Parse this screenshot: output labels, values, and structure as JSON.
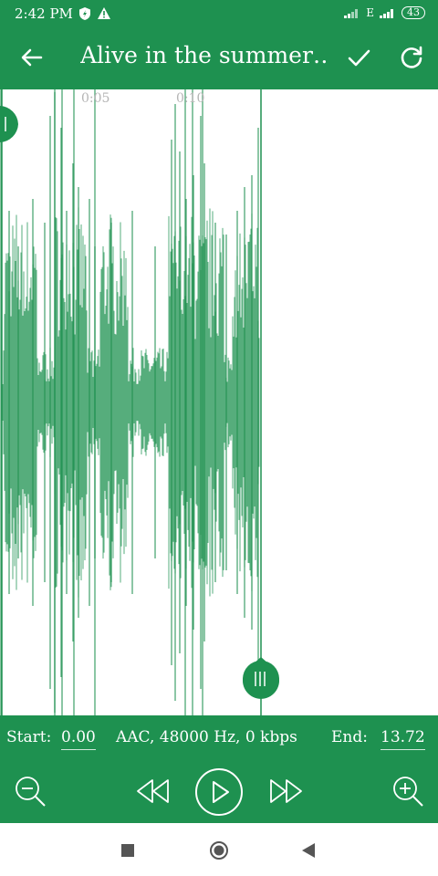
{
  "status": {
    "time": "2:42 PM",
    "network": "E",
    "battery": "43"
  },
  "appbar": {
    "title": "Alive in the summer…"
  },
  "timeline": {
    "ticks": [
      "0:05",
      "0:10"
    ]
  },
  "bottom": {
    "start_label": "Start:",
    "start_value": "0.00",
    "info": "AAC, 48000 Hz, 0 kbps",
    "end_label": "End:",
    "end_value": "13.72"
  },
  "colors": {
    "primary": "#1e9150",
    "wave": "#1e9150"
  },
  "icons": [
    "back-arrow-icon",
    "check-icon",
    "refresh-icon",
    "zoom-out-icon",
    "rewind-icon",
    "play-icon",
    "fast-forward-icon",
    "zoom-in-icon",
    "stop-icon",
    "home-icon",
    "back-triangle-icon"
  ]
}
